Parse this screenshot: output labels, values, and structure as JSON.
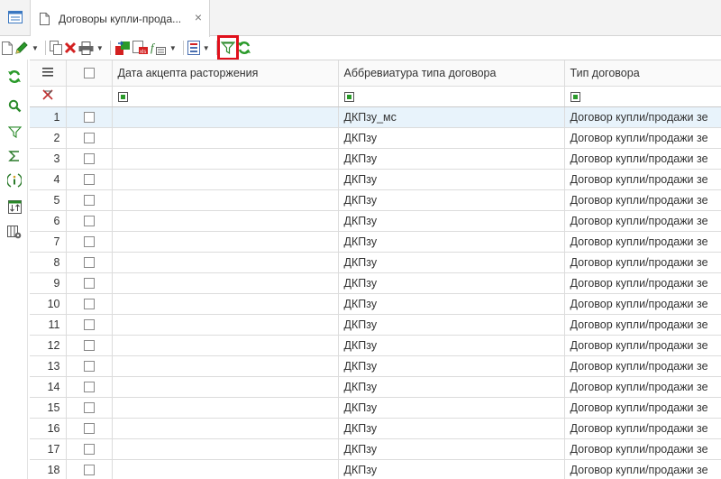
{
  "tab": {
    "title": "Договоры купли-прода...",
    "close": "×"
  },
  "grid": {
    "menu_icon": "hamburger-icon",
    "columns": [
      "Дата акцепта расторжения",
      "Аббревиатура типа договора",
      "Тип договора"
    ],
    "rows": [
      {
        "n": "1",
        "date": "",
        "abbr": "ДКПзу_мс",
        "type": "Договор купли/продажи зе"
      },
      {
        "n": "2",
        "date": "",
        "abbr": "ДКПзу",
        "type": "Договор купли/продажи зе"
      },
      {
        "n": "3",
        "date": "",
        "abbr": "ДКПзу",
        "type": "Договор купли/продажи зе"
      },
      {
        "n": "4",
        "date": "",
        "abbr": "ДКПзу",
        "type": "Договор купли/продажи зе"
      },
      {
        "n": "5",
        "date": "",
        "abbr": "ДКПзу",
        "type": "Договор купли/продажи зе"
      },
      {
        "n": "6",
        "date": "",
        "abbr": "ДКПзу",
        "type": "Договор купли/продажи зе"
      },
      {
        "n": "7",
        "date": "",
        "abbr": "ДКПзу",
        "type": "Договор купли/продажи зе"
      },
      {
        "n": "8",
        "date": "",
        "abbr": "ДКПзу",
        "type": "Договор купли/продажи зе"
      },
      {
        "n": "9",
        "date": "",
        "abbr": "ДКПзу",
        "type": "Договор купли/продажи зе"
      },
      {
        "n": "10",
        "date": "",
        "abbr": "ДКПзу",
        "type": "Договор купли/продажи зе"
      },
      {
        "n": "11",
        "date": "",
        "abbr": "ДКПзу",
        "type": "Договор купли/продажи зе"
      },
      {
        "n": "12",
        "date": "",
        "abbr": "ДКПзу",
        "type": "Договор купли/продажи зе"
      },
      {
        "n": "13",
        "date": "",
        "abbr": "ДКПзу",
        "type": "Договор купли/продажи зе"
      },
      {
        "n": "14",
        "date": "",
        "abbr": "ДКПзу",
        "type": "Договор купли/продажи зе"
      },
      {
        "n": "15",
        "date": "",
        "abbr": "ДКПзу",
        "type": "Договор купли/продажи зе"
      },
      {
        "n": "16",
        "date": "",
        "abbr": "ДКПзу",
        "type": "Договор купли/продажи зе"
      },
      {
        "n": "17",
        "date": "",
        "abbr": "ДКПзу",
        "type": "Договор купли/продажи зе"
      },
      {
        "n": "18",
        "date": "",
        "abbr": "ДКПзу",
        "type": "Договор купли/продажи зе"
      }
    ]
  },
  "toolbar_icons": [
    "new-document-icon",
    "edit-icon",
    "copy-icon",
    "delete-icon",
    "print-icon",
    "export-icon",
    "import-icon",
    "formula-icon",
    "report-icon",
    "filter-icon",
    "refresh-icon"
  ],
  "leftbar_icons": [
    "refresh-icon",
    "search-icon",
    "filter-icon",
    "sum-icon",
    "info-icon",
    "sort-icon",
    "column-settings-icon"
  ],
  "colors": {
    "accent": "#2a9a2a",
    "highlight": "#e0101b",
    "selected_row": "#e8f3fb"
  }
}
